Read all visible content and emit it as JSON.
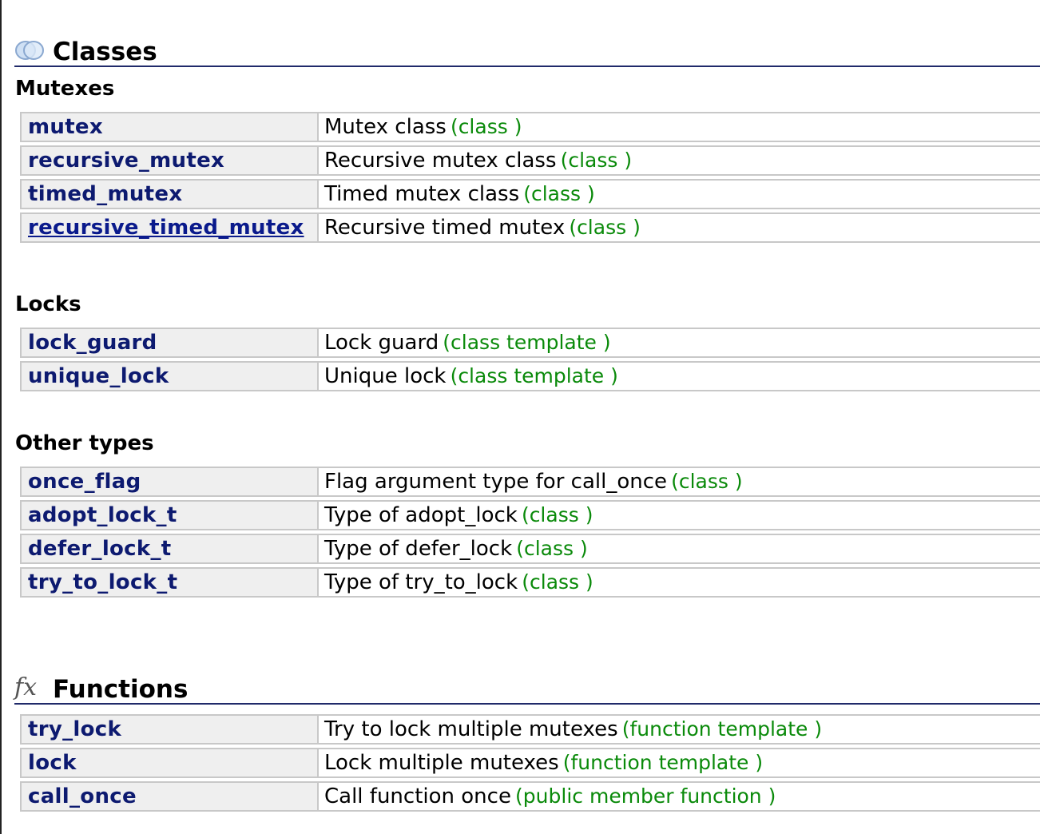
{
  "classes": {
    "title": "Classes",
    "icon": "classes-rings-icon",
    "groups": [
      {
        "title": "Mutexes",
        "rows": [
          {
            "name": "mutex",
            "desc": "Mutex class",
            "kind": "(class )"
          },
          {
            "name": "recursive_mutex",
            "desc": "Recursive mutex class",
            "kind": "(class )"
          },
          {
            "name": "timed_mutex",
            "desc": "Timed mutex class",
            "kind": "(class )"
          },
          {
            "name": "recursive_timed_mutex",
            "desc": "Recursive timed mutex",
            "kind": "(class )"
          }
        ]
      },
      {
        "title": "Locks",
        "rows": [
          {
            "name": "lock_guard",
            "desc": "Lock guard",
            "kind": "(class template )"
          },
          {
            "name": "unique_lock",
            "desc": "Unique lock",
            "kind": "(class template )"
          }
        ]
      },
      {
        "title": "Other types",
        "rows": [
          {
            "name": "once_flag",
            "desc": "Flag argument type for call_once",
            "kind": "(class )"
          },
          {
            "name": "adopt_lock_t",
            "desc": "Type of adopt_lock",
            "kind": "(class )"
          },
          {
            "name": "defer_lock_t",
            "desc": "Type of defer_lock",
            "kind": "(class )"
          },
          {
            "name": "try_to_lock_t",
            "desc": "Type of try_to_lock",
            "kind": "(class )"
          }
        ]
      }
    ]
  },
  "functions": {
    "title": "Functions",
    "icon": "fx-function-icon",
    "icon_glyph": "fx",
    "rows": [
      {
        "name": "try_lock",
        "desc": "Try to lock multiple mutexes",
        "kind": "(function template )"
      },
      {
        "name": "lock",
        "desc": "Lock multiple mutexes",
        "kind": "(function template )"
      },
      {
        "name": "call_once",
        "desc": "Call function once",
        "kind": "(public member function )"
      }
    ]
  },
  "colors": {
    "name_link": "#0d1a70",
    "kind_text": "#0a8a0a",
    "header_rule": "#202a6a",
    "name_cell_bg": "#efefef"
  }
}
